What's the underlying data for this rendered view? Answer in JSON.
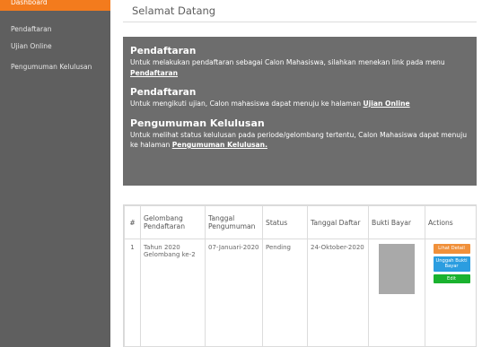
{
  "sidebar": {
    "active": "Dashboard",
    "items": [
      {
        "label": "Pendaftaran"
      },
      {
        "label": "Ujian Online"
      },
      {
        "label": "Pengumuman Kelulusan"
      }
    ]
  },
  "header": {
    "title": "Selamat Datang"
  },
  "info": {
    "blocks": [
      {
        "title": "Pendaftaran",
        "text": "Untuk melakukan pendaftaran sebagai Calon Mahasiswa, silahkan menekan link pada menu",
        "link": "Pendaftaran"
      },
      {
        "title": "Pendaftaran",
        "text": "Untuk mengikuti ujian, Calon mahasiswa dapat menuju ke halaman",
        "link": "Ujian Online"
      },
      {
        "title": "Pengumuman Kelulusan",
        "text": "Untuk melihat status kelulusan pada periode/gelombang tertentu, Calon Mahasiswa dapat menuju ke halaman",
        "link": "Pengumuman Kelulusan."
      }
    ]
  },
  "table": {
    "headers": [
      "#",
      "Gelombang Pendaftaran",
      "Tanggal Pengumuman",
      "Status",
      "Tanggal Daftar",
      "Bukti Bayar",
      "Actions"
    ],
    "rows": [
      {
        "no": "1",
        "gelombang": "Tahun 2020 Gelombang ke-2",
        "tanggal_pengumuman": "07-Januari-2020",
        "status": "Pending",
        "tanggal_daftar": "24-Oktober-2020"
      }
    ],
    "actions": {
      "detail": "Lihat Detail",
      "upload": "Unggah Bukti Bayar",
      "edit": "Edit"
    }
  },
  "colors": {
    "accent": "#f37b1d",
    "sidebar": "#5f5f5f",
    "panel": "#6d6d6d"
  }
}
